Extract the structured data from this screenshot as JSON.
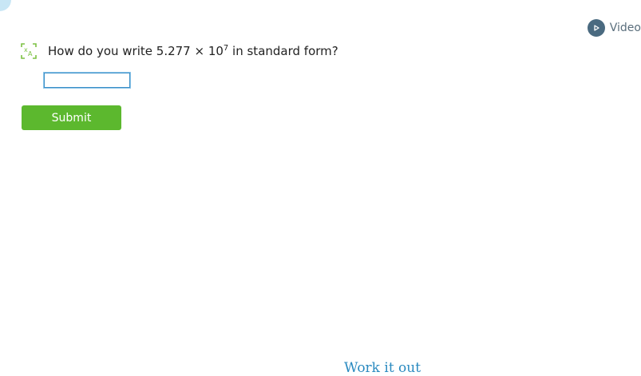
{
  "header": {
    "video_label": "Video"
  },
  "question": {
    "prefix": "How do you write 5.277 × 10",
    "exponent": "7",
    "suffix": " in standard form?"
  },
  "answer": {
    "value": "",
    "placeholder": ""
  },
  "actions": {
    "submit_label": "Submit"
  },
  "footer": {
    "work_it_out_label": "Work it out"
  },
  "colors": {
    "accent_green": "#5cb82e",
    "link_blue": "#2a8ac0",
    "video_icon": "#4a6a80",
    "translate_icon": "#7cc143"
  },
  "icons": {
    "video": "play-circle-icon",
    "translate": "translate-icon"
  }
}
